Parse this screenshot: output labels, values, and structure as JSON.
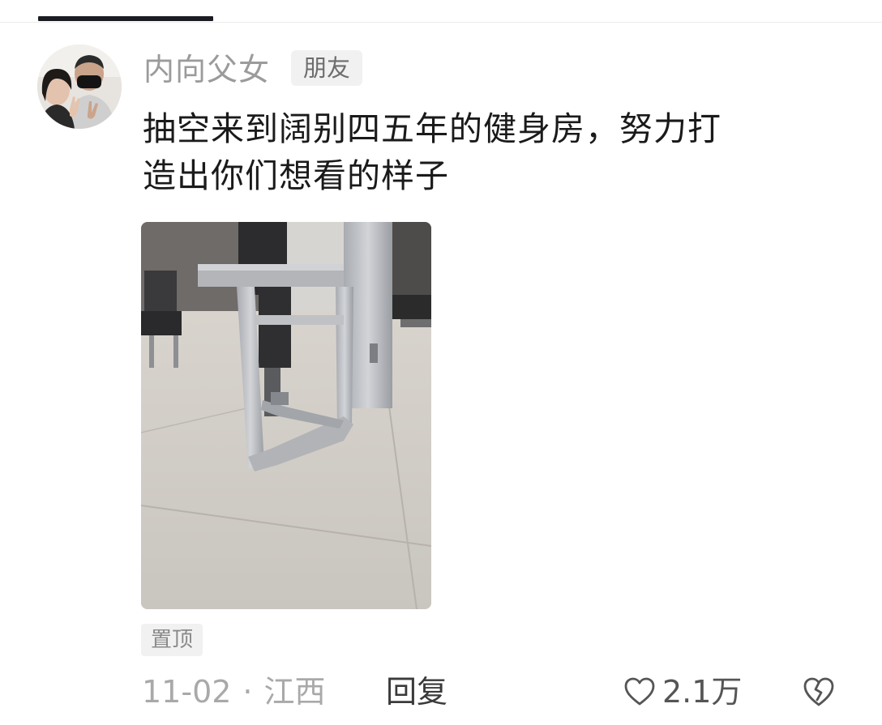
{
  "comment": {
    "author": "内向父女",
    "badge": "朋友",
    "text_line1": "抽空来到阔别四五年的健身房，努力打",
    "text_line2": "造出你们想看的样子",
    "pin_label": "置顶",
    "date": "11-02",
    "separator": "·",
    "location": "江西",
    "reply_label": "回复",
    "like_count": "2.1万"
  },
  "icons": {
    "like": "heart-outline-icon",
    "dislike": "broken-heart-icon"
  },
  "colors": {
    "text_primary": "#1a1a1a",
    "text_secondary": "#9b9b9b",
    "badge_bg": "#f1f1f1",
    "tab_indicator": "#1b1b24"
  }
}
